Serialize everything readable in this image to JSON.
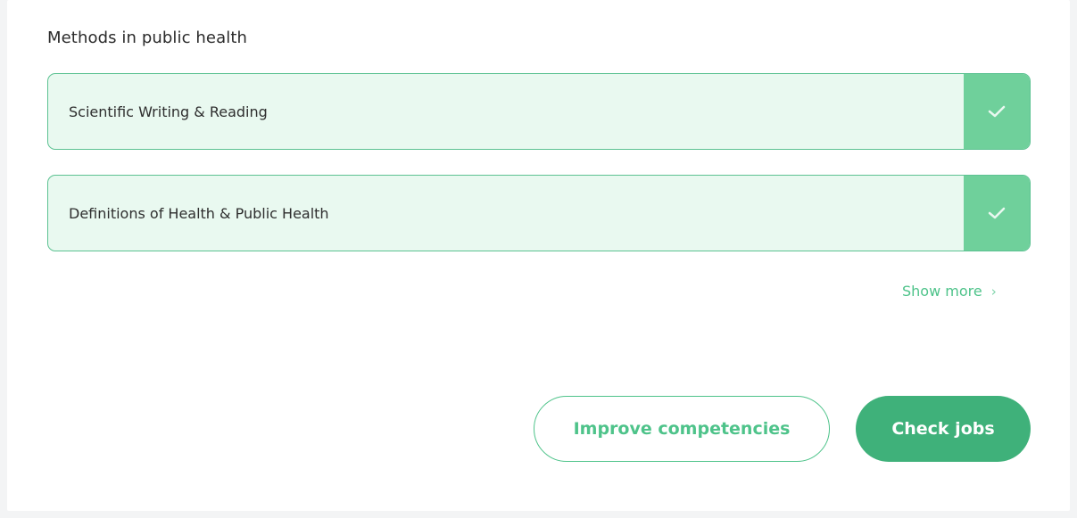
{
  "section": {
    "title": "Methods in public health"
  },
  "skills": [
    {
      "label": "Scientific Writing & Reading",
      "checked": true
    },
    {
      "label": "Definitions of Health & Public Health",
      "checked": true
    }
  ],
  "show_more": {
    "label": "Show more",
    "chevron": "›"
  },
  "actions": {
    "improve_label": "Improve competencies",
    "jobs_label": "Check jobs"
  },
  "colors": {
    "accent": "#4ec38a",
    "accent_dark": "#3fb17a",
    "row_bg": "#e9f9f0",
    "check_bg": "#6fd09b"
  },
  "icons": {
    "row_status": "checkmark-icon",
    "show_more": "chevron-right-icon"
  }
}
